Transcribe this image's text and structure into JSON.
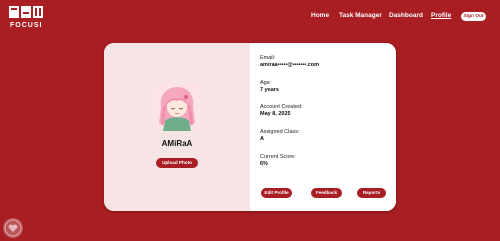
{
  "header": {
    "brand": "FOCUSI",
    "nav": [
      "Home",
      "Task Manager",
      "Dashboard",
      "Profile"
    ],
    "active_nav": "Profile",
    "sign_out": "Sign Out"
  },
  "profile": {
    "username": "AMiRaA",
    "upload_label": "Upload Photo",
    "email_label": "Email:",
    "email_value": "amiraa•••••@•••••••.com",
    "age_label": "Age:",
    "age_value": "7 years",
    "created_label": "Account Created:",
    "created_value": "May 8, 2025",
    "class_label": "Assigned Class:",
    "class_value": "A",
    "score_label": "Current Score:",
    "score_value": "6%"
  },
  "actions": {
    "edit": "Edit Profile",
    "feedback": "Feedback",
    "reports": "Reports"
  },
  "colors": {
    "brand": "#a81e22",
    "panel_left": "#f7e4e4",
    "panel_right": "#ffffff"
  }
}
